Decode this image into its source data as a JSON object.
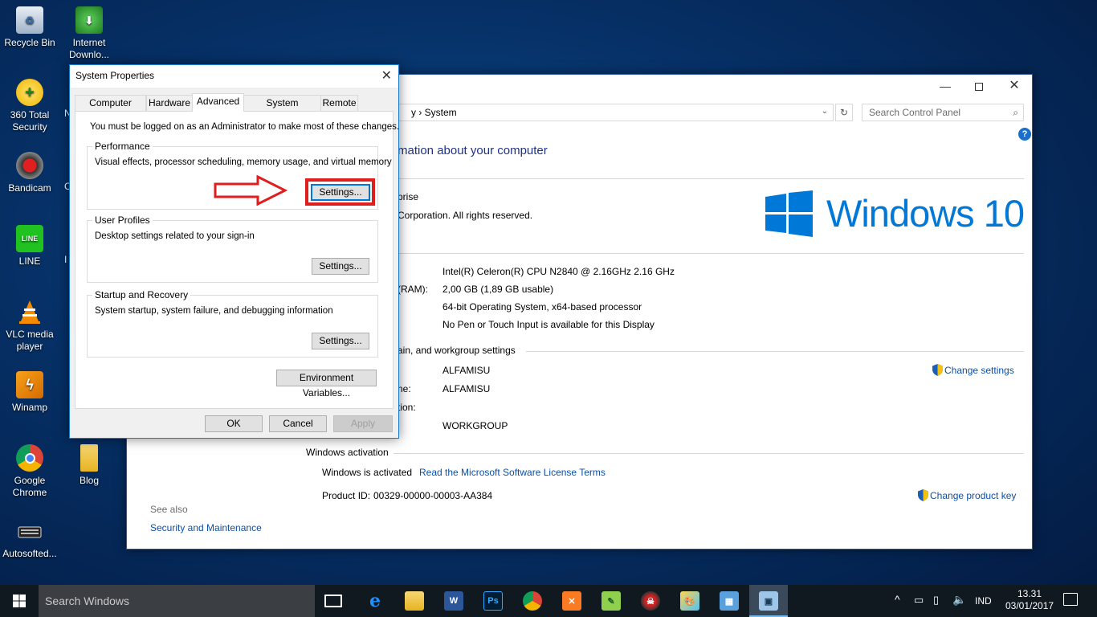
{
  "desktop": {
    "icons": [
      {
        "label": "Recycle Bin"
      },
      {
        "label": "Internet Downlo..."
      },
      {
        "label": "360 Total Security"
      },
      {
        "label": "Bandicam"
      },
      {
        "label": "LINE"
      },
      {
        "label": "VLC media player"
      },
      {
        "label": "Winamp"
      },
      {
        "label": "Google Chrome"
      },
      {
        "label": "Blog"
      },
      {
        "label": "Autosofted..."
      }
    ],
    "partial_letters": [
      "N",
      "C",
      "I"
    ]
  },
  "control_panel": {
    "breadcrumb_tail": "y  ›  System",
    "search_placeholder": "Search Control Panel",
    "heading": "mation about your computer",
    "edition_partial": "prise",
    "copyright_partial": "Corporation. All rights reserved.",
    "logo_text": "Windows 10",
    "system": {
      "processor": "Intel(R) Celeron(R) CPU  N2840  @ 2.16GHz   2.16 GHz",
      "ram_label_partial": "(RAM):",
      "ram": "2,00 GB (1,89 GB usable)",
      "system_type": "64-bit Operating System, x64-based processor",
      "pen_touch": "No Pen or Touch Input is available for this Display"
    },
    "computer_name_section": "ain, and workgroup settings",
    "computer_name": "ALFAMISU",
    "full_name_label_partial": "ne:",
    "full_name": "ALFAMISU",
    "description_label_partial": "tion:",
    "workgroup": "WORKGROUP",
    "change_settings": "Change settings",
    "activation_section": "Windows activation",
    "activated": "Windows is activated",
    "license_link": "Read the Microsoft Software License Terms",
    "product_id_label": "Product ID:",
    "product_id": "00329-00000-00003-AA384",
    "change_product_key": "Change product key",
    "see_also": "See also",
    "security_maintenance": "Security and Maintenance"
  },
  "dialog": {
    "title": "System Properties",
    "tabs": [
      "Computer Name",
      "Hardware",
      "Advanced",
      "System Protection",
      "Remote"
    ],
    "active_tab": "Advanced",
    "admin_note": "You must be logged on as an Administrator to make most of these changes.",
    "performance": {
      "label": "Performance",
      "desc": "Visual effects, processor scheduling, memory usage, and virtual memory",
      "button": "Settings..."
    },
    "user_profiles": {
      "label": "User Profiles",
      "desc": "Desktop settings related to your sign-in",
      "button": "Settings..."
    },
    "startup": {
      "label": "Startup and Recovery",
      "desc": "System startup, system failure, and debugging information",
      "button": "Settings..."
    },
    "env_button": "Environment Variables...",
    "ok": "OK",
    "cancel": "Cancel",
    "apply": "Apply"
  },
  "taskbar": {
    "search_placeholder": "Search Windows",
    "language": "IND",
    "time": "13.31",
    "date": "03/01/2017"
  },
  "colors": {
    "accent": "#0078d7",
    "highlight": "#e81123",
    "link": "#0b4fa6",
    "logo": "#0078d7"
  }
}
